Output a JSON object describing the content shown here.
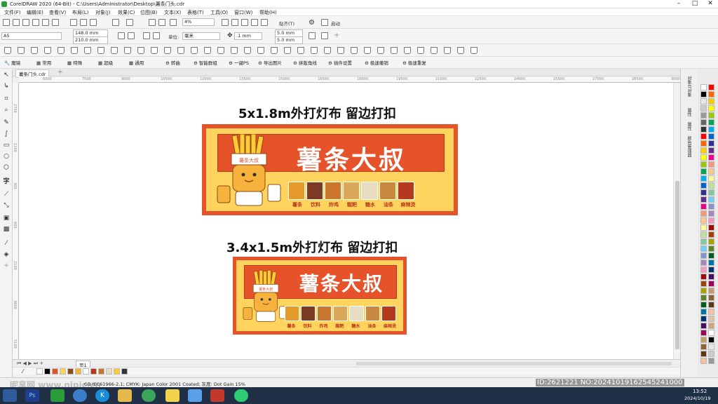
{
  "window": {
    "title": "CorelDRAW 2020 (64-Bit) - C:\\Users\\Administrator\\Desktop\\薯条门头.cdr"
  },
  "menu": [
    "文件(F)",
    "编辑(E)",
    "查看(V)",
    "布局(L)",
    "对象(J)",
    "效果(C)",
    "位图(B)",
    "文本(X)",
    "表格(T)",
    "工具(O)",
    "窗口(W)",
    "帮助(H)"
  ],
  "toolbar": {
    "zoom": "4%",
    "snap_label": "贴齐(T)",
    "launch_label": "启动"
  },
  "property_bar": {
    "page_size": "A5",
    "width": "148.0 mm",
    "height": "210.0 mm",
    "units_label": "单位:",
    "units_value": "毫米",
    "nudge": ".1 mm",
    "dup_x": "5.0 mm",
    "dup_y": "5.0 mm"
  },
  "plugin_bar": [
    "魔镜",
    "常用",
    "特殊",
    "超级",
    "通用",
    "转曲",
    "智能群组",
    "一键PS",
    "导出图片",
    "拼版角线",
    "插件设置",
    "极速撤销",
    "极速重复"
  ],
  "doc_tab": "薯条门头.cdr",
  "ruler_h_ticks": [
    "6000",
    "7500",
    "9000",
    "10500",
    "12000",
    "13500",
    "15000",
    "16500",
    "18000",
    "19500",
    "21000",
    "22500",
    "24000",
    "25500",
    "27000",
    "28500",
    "30000"
  ],
  "ruler_v_ticks": [
    "2700",
    "1200",
    "300",
    "600",
    "2100",
    "3600",
    "5100"
  ],
  "design": {
    "heading1": "5x1.8m外打灯布 留边打扣",
    "heading2": "3.4x1.5m外打灯布 留边打扣",
    "brand": "薯条大叔",
    "mascot_hat_text": "薯条大叔",
    "categories": [
      "薯条",
      "饮料",
      "炸鸡",
      "糍粑",
      "糖水",
      "油条",
      "麻辣烫"
    ]
  },
  "right_dock": [
    "对象与对象",
    "属性",
    "属性",
    "颜色管理器"
  ],
  "page_tab": "页1",
  "status": "GB IEC61966-2.1; CMYK: Japan Color 2001 Coated; 灰度: Dot Gain 15%",
  "watermark": "昵享网 www.nipic.cn",
  "watermark_id": "ID:2621221 NO:20241019162545241000",
  "clock": {
    "time": "13:52",
    "date": "2024/10/19"
  },
  "colors": {
    "sign_orange": "#e6532a",
    "sign_yellow": "#ffd45e",
    "accent_green": "#2a9d3a",
    "taskbar": "#1f2f45"
  }
}
